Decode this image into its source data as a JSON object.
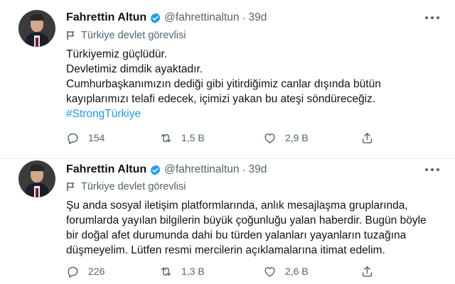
{
  "tweets": [
    {
      "author_name": "Fahrettin Altun",
      "handle": "@fahrettinaltun",
      "separator": "·",
      "time": "39d",
      "label": "Türkiye devlet görevlisi",
      "lines": [
        "Türkiyemiz güçlüdür.",
        "Devletimiz dimdik ayaktadır.",
        "Cumhurbaşkanımızın dediği gibi yitirdiğimiz canlar dışında bütün",
        "kayıplarımızı telafi edecek, içimizi yakan bu ateşi söndüreceğiz."
      ],
      "hashtag": "#StrongTürkiye",
      "replies": "154",
      "retweets": "1,5 B",
      "likes": "2,9 B"
    },
    {
      "author_name": "Fahrettin Altun",
      "handle": "@fahrettinaltun",
      "separator": "·",
      "time": "39d",
      "label": "Türkiye devlet görevlisi",
      "lines": [
        "Şu anda sosyal iletişim platformlarında, anlık mesajlaşma gruplarında,",
        "forumlarda yayılan bilgilerin büyük çoğunluğu yalan haberdir. Bugün böyle",
        "bir doğal afet durumunda dahi bu türden yalanları yayanların tuzağına",
        "düşmeyelim. Lütfen resmi mercilerin açıklamalarına itimat edelim."
      ],
      "replies": "226",
      "retweets": "1,3 B",
      "likes": "2,6 B"
    }
  ],
  "icons": {
    "verified": "verified-badge-icon",
    "more": "more-dots-icon",
    "label": "flag-icon",
    "reply": "reply-bubble-icon",
    "retweet": "retweet-icon",
    "like": "heart-icon",
    "share": "share-icon"
  },
  "colors": {
    "verified": "#1d9bf0",
    "hashtag": "#1d9bf0",
    "secondary_text": "#536471",
    "divider": "#e6ecf0"
  }
}
